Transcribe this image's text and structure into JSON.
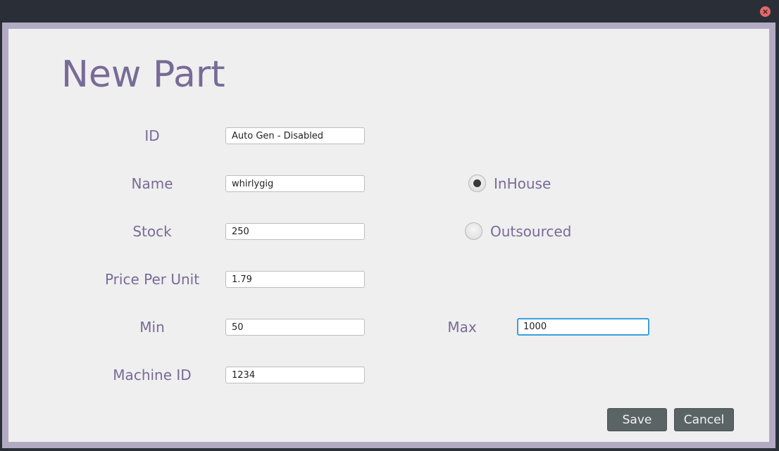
{
  "window": {
    "close_icon": "close-icon",
    "close_glyph": "×"
  },
  "page": {
    "title": "New Part"
  },
  "form": {
    "id": {
      "label": "ID",
      "value": "Auto Gen - Disabled"
    },
    "name": {
      "label": "Name",
      "value": "whirlygig"
    },
    "stock": {
      "label": "Stock",
      "value": "250"
    },
    "price": {
      "label": "Price Per Unit",
      "value": "1.79"
    },
    "min": {
      "label": "Min",
      "value": "50"
    },
    "max": {
      "label": "Max",
      "value": "1000"
    },
    "machine_id": {
      "label": "Machine ID",
      "value": "1234"
    }
  },
  "source": {
    "inhouse": {
      "label": "InHouse",
      "selected": true
    },
    "outsourced": {
      "label": "Outsourced",
      "selected": false
    }
  },
  "buttons": {
    "save": "Save",
    "cancel": "Cancel"
  },
  "colors": {
    "accent": "#786b97",
    "frame": "#b3abc4",
    "button": "#5b6464",
    "focus": "#3aa0dc"
  }
}
